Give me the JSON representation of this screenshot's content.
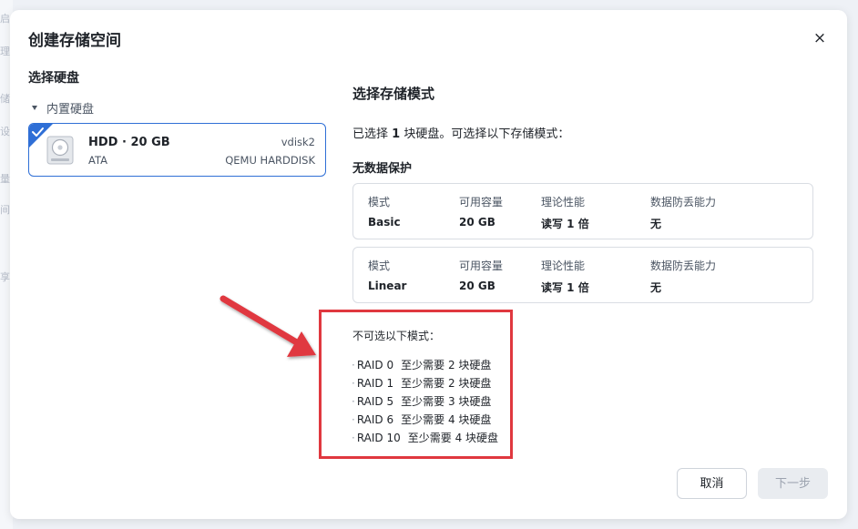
{
  "background": {
    "glyphs": [
      "启",
      "理",
      "储",
      "设",
      "量",
      "间",
      "享"
    ]
  },
  "dialog": {
    "title": "创建存储空间",
    "close_label": "×"
  },
  "left": {
    "title": "选择硬盘",
    "group_label": "内置硬盘",
    "disk": {
      "name": "HDD · 20 GB",
      "vendor": "ATA",
      "id": "vdisk2",
      "model": "QEMU HARDDISK",
      "selected": true
    }
  },
  "right": {
    "title": "选择存储模式",
    "selected_prefix": "已选择 ",
    "selected_count": "1",
    "selected_suffix": " 块硬盘。可选择以下存储模式：",
    "section_title": "无数据保护",
    "headers": {
      "mode": "模式",
      "capacity": "可用容量",
      "performance": "理论性能",
      "protection": "数据防丢能力"
    },
    "modes": [
      {
        "mode": "Basic",
        "capacity": "20 GB",
        "performance": "读写 1 倍",
        "protection": "无"
      },
      {
        "mode": "Linear",
        "capacity": "20 GB",
        "performance": "读写 1 倍",
        "protection": "无"
      }
    ],
    "unavailable_title": "不可选以下模式：",
    "unavailable": [
      {
        "name": "RAID 0",
        "requirement": "至少需要 2 块硬盘"
      },
      {
        "name": "RAID 1",
        "requirement": "至少需要 2 块硬盘"
      },
      {
        "name": "RAID 5",
        "requirement": "至少需要 3 块硬盘"
      },
      {
        "name": "RAID 6",
        "requirement": "至少需要 4 块硬盘"
      },
      {
        "name": "RAID 10",
        "requirement": "至少需要 4 块硬盘"
      }
    ]
  },
  "buttons": {
    "cancel": "取消",
    "next": "下一步"
  },
  "colors": {
    "accent": "#2f6fd6",
    "annotation": "#e0383f",
    "disabled_bg": "#e9ecf0"
  }
}
